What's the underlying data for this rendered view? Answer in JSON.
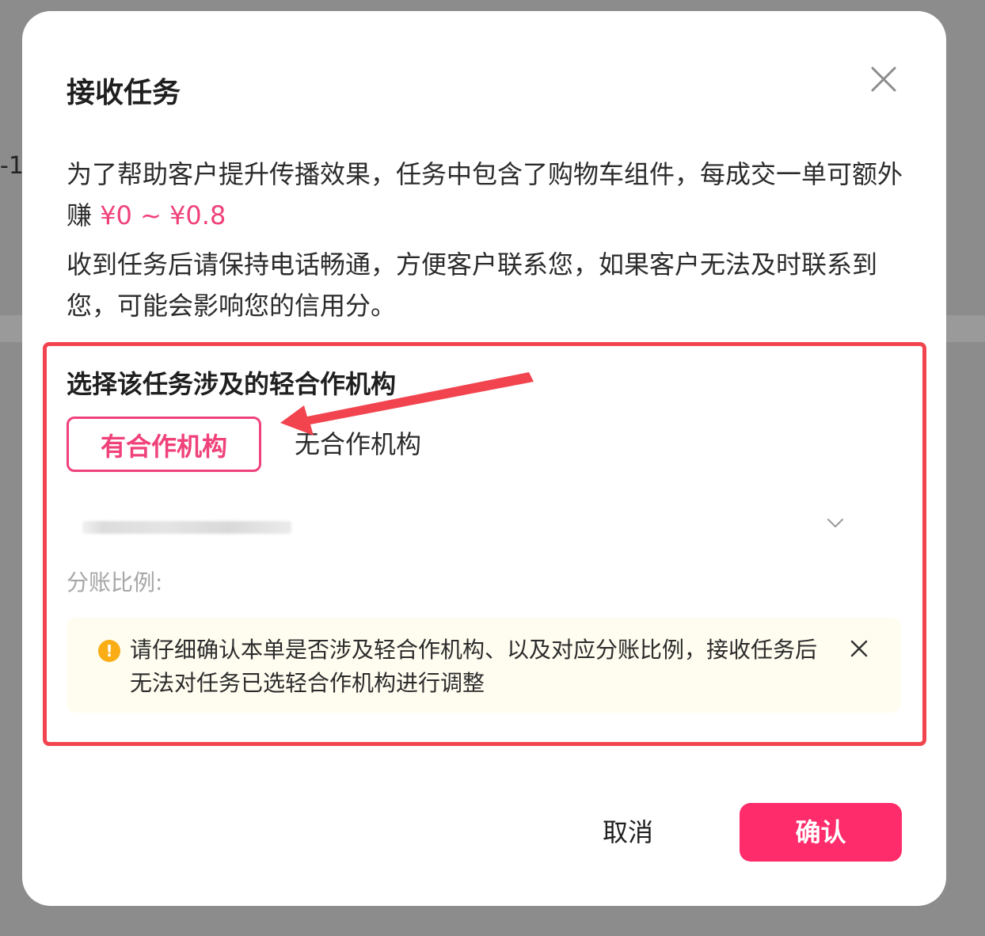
{
  "backdrop": {
    "partial_text": "-1"
  },
  "dialog": {
    "title": "接收任务",
    "desc_line1_prefix": "为了帮助客户提升传播效果，任务中包含了购物车组件，每成交一单可额外赚 ",
    "price_range": "¥0 ~ ¥0.8",
    "desc_line2": "收到任务后请保持电话畅通，方便客户联系您，如果客户无法及时联系到您，可能会影响您的信用分。",
    "section_title": "选择该任务涉及的轻合作机构",
    "options": [
      {
        "label": "有合作机构",
        "selected": true
      },
      {
        "label": "无合作机构",
        "selected": false
      }
    ],
    "select_icon": "chevron-down-icon",
    "split_ratio_label": "分账比例:",
    "notice": {
      "icon": "exclamation-circle-icon",
      "text": "请仔细确认本单是否涉及轻合作机构、以及对应分账比例，接收任务后无法对任务已选轻合作机构进行调整"
    },
    "cancel_label": "取消",
    "confirm_label": "确认"
  },
  "colors": {
    "accent": "#fe2c6a",
    "price": "#f0427a",
    "highlight_border": "#f2444e",
    "warning": "#faad14",
    "notice_bg": "#fffdf0"
  }
}
